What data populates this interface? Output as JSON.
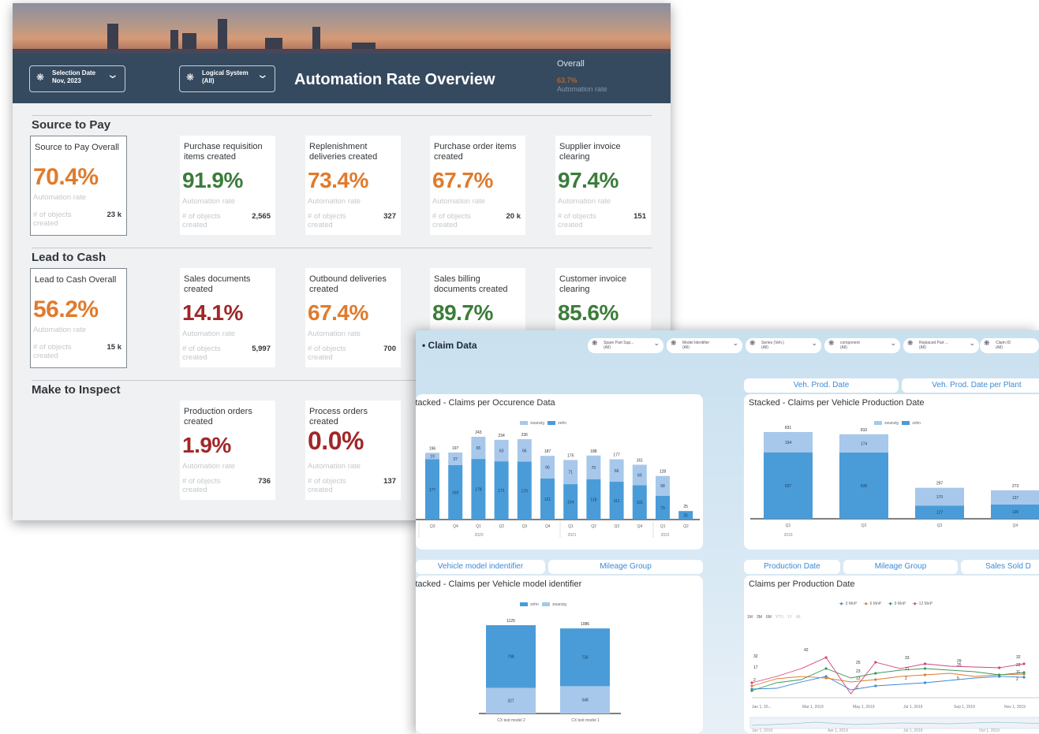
{
  "overview": {
    "filters": [
      {
        "label": "Selection Date",
        "value": "Nov, 2023"
      },
      {
        "label": "Logical System",
        "value": "(All)"
      }
    ],
    "title": "Automation Rate Overview",
    "overall": {
      "label": "Overall",
      "value": "63.7%",
      "sub": "Automation rate"
    },
    "rate_label": "Automation rate",
    "objects_label": "# of objects created",
    "sections": [
      {
        "title": "Source to Pay",
        "cards": [
          {
            "title": "Source to Pay Overall",
            "value": "70.4%",
            "count": "23 k",
            "status": "orange",
            "overall": true
          },
          {
            "title": "Purchase requisition items created",
            "value": "91.9%",
            "count": "2,565",
            "status": "green"
          },
          {
            "title": "Replenishment deliveries created",
            "value": "73.4%",
            "count": "327",
            "status": "orange"
          },
          {
            "title": "Purchase order items created",
            "value": "67.7%",
            "count": "20 k",
            "status": "orange"
          },
          {
            "title": "Supplier invoice clearing",
            "value": "97.4%",
            "count": "151",
            "status": "green"
          }
        ]
      },
      {
        "title": "Lead to Cash",
        "cards": [
          {
            "title": "Lead to Cash Overall",
            "value": "56.2%",
            "count": "15 k",
            "status": "orange",
            "overall": true
          },
          {
            "title": "Sales documents created",
            "value": "14.1%",
            "count": "5,997",
            "status": "red"
          },
          {
            "title": "Outbound deliveries created",
            "value": "67.4%",
            "count": "700",
            "status": "orange"
          },
          {
            "title": "Sales billing documents created",
            "value": "89.7%",
            "count": "",
            "status": "green"
          },
          {
            "title": "Customer invoice clearing",
            "value": "85.6%",
            "count": "",
            "status": "green"
          }
        ]
      },
      {
        "title": "Make to Inspect",
        "cards": [
          {
            "title": "Production orders created",
            "value": "1.9%",
            "count": "736",
            "status": "red"
          },
          {
            "title": "Process orders created",
            "value": "0.0%",
            "count": "137",
            "status": "red"
          }
        ]
      }
    ],
    "colors": {
      "orange": "#e07b2d",
      "green": "#3a7d3a",
      "red": "#a12728",
      "header": "#354a5f"
    }
  },
  "claims": {
    "title": "Claim Data",
    "filters": [
      {
        "label": "Spare Part Sup...",
        "value": "(All)"
      },
      {
        "label": "Model Identifier",
        "value": "(All)"
      },
      {
        "label": "Series (Veh.)",
        "value": "(All)"
      },
      {
        "label": "component",
        "value": "(All)"
      },
      {
        "label": "Replaced Part ...",
        "value": "(All)"
      },
      {
        "label": "Claim ID",
        "value": "(All)"
      }
    ],
    "top_tabs_right": [
      "Veh. Prod. Date",
      "Veh. Prod. Date per Plant"
    ],
    "bottom_tabs_left": [
      "Vehicle model indentifier",
      "Mileage Group"
    ],
    "bottom_tabs_right": [
      "Production Date",
      "Mileage Group",
      "Sales Sold D"
    ],
    "time_buttons": [
      "1M",
      "3M",
      "6M",
      "YTD",
      "1Y",
      "All"
    ]
  },
  "chart_data": [
    {
      "type": "bar",
      "title": "Stacked - Claims per Occurence Data",
      "stacked": true,
      "categories": [
        "Q2",
        "Q3",
        "Q4",
        "Q1",
        "Q2",
        "Q3",
        "Q4",
        "Q1",
        "Q2",
        "Q3",
        "Q4",
        "Q1",
        "Q2"
      ],
      "groups": [
        "2020",
        "2021",
        "2022"
      ],
      "totals": [
        196,
        197,
        243,
        234,
        236,
        187,
        175,
        188,
        177,
        161,
        128,
        25
      ],
      "series": [
        {
          "name": "zwanzig",
          "values": [
            19,
            37,
            65,
            63,
            66,
            66,
            71,
            70,
            66,
            60,
            58,
            0
          ]
        },
        {
          "name": "zehn",
          "values": [
            177,
            160,
            178,
            171,
            170,
            121,
            104,
            118,
            111,
            101,
            70,
            25
          ]
        }
      ],
      "colors": {
        "zwanzig": "#a7c8ea",
        "zehn": "#4a9cd8"
      }
    },
    {
      "type": "bar",
      "title": "Stacked - Claims per Vehicle Production Date",
      "stacked": true,
      "categories": [
        "Q1",
        "Q2",
        "Q3",
        "Q4"
      ],
      "groups": [
        "2019"
      ],
      "totals": [
        831,
        810,
        297,
        273
      ],
      "series": [
        {
          "name": "zwanzig",
          "values": [
            194,
            174,
            170,
            137
          ]
        },
        {
          "name": "zehn",
          "values": [
            637,
            636,
            127,
            136
          ]
        }
      ]
    },
    {
      "type": "bar",
      "title": "Stacked - Claims per Vehicle model identifier",
      "stacked": true,
      "categories": [
        "CX test model 2",
        "CX test model 1"
      ],
      "totals": [
        1125,
        1086
      ],
      "series": [
        {
          "name": "zehn",
          "values": [
            798,
            736
          ]
        },
        {
          "name": "zwanzig",
          "values": [
            327,
            348
          ]
        }
      ]
    },
    {
      "type": "line",
      "title": "Claims per Production Date",
      "series": [
        {
          "name": "3 MnP",
          "color": "#3c8ad6"
        },
        {
          "name": "6 MnP",
          "color": "#e07b2d"
        },
        {
          "name": "9 MnP",
          "color": "#3a9a5a"
        },
        {
          "name": "12 MnP",
          "color": "#d1457a"
        }
      ],
      "x_ticks": [
        "Jan 1, 20...",
        "Mar 1, 2019",
        "May 1, 2019",
        "Jul 1, 2019",
        "Sep 1, 2019",
        "Nov 1, 2019"
      ],
      "navigator_ticks": [
        "Jan 1, 2019",
        "Apr 1, 2019",
        "Jul 1, 2019",
        "Oct 1, 2019"
      ],
      "labels": [
        "32",
        "17",
        "2",
        "42",
        "25",
        "23",
        "13",
        "2",
        "33",
        "21",
        "2",
        "29",
        "25",
        "5",
        "32",
        "22",
        "11",
        "2"
      ]
    }
  ]
}
